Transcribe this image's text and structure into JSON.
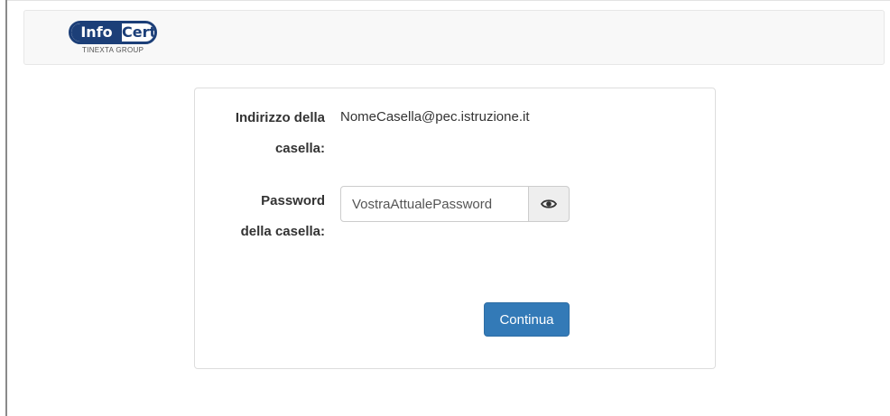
{
  "header": {
    "logo": {
      "text_left": "Info",
      "text_right": "Cert",
      "subtitle": "TINEXTA GROUP",
      "brand_color": "#1c3f78"
    }
  },
  "form": {
    "email_label_line1": "Indirizzo della",
    "email_label_line2": "casella:",
    "email_value": "NomeCasella@pec.istruzione.it",
    "password_label_line1": "Password",
    "password_label_line2": "della casella:",
    "password_value": "VostraAttualePassword",
    "toggle_icon": "eye-icon",
    "submit_label": "Continua",
    "submit_color": "#337ab7"
  }
}
